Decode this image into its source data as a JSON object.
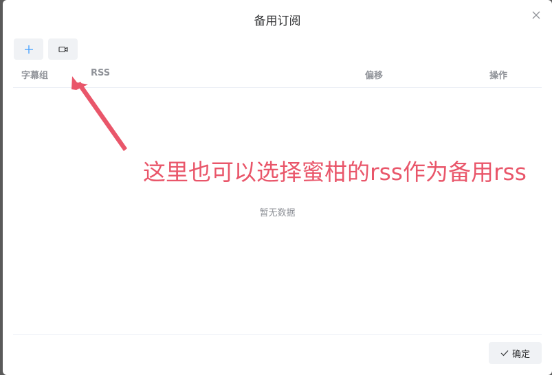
{
  "dialog": {
    "title": "备用订阅"
  },
  "toolbar": {
    "add_icon": "plus-icon",
    "video_icon": "video-camera-icon"
  },
  "table": {
    "columns": [
      "字幕组",
      "RSS",
      "偏移",
      "操作"
    ],
    "rows": [],
    "empty_text": "暂无数据"
  },
  "annotation": {
    "text": "这里也可以选择蜜柑的rss作为备用rss",
    "color": "#e9566a"
  },
  "footer": {
    "confirm_label": "确定",
    "confirm_icon": "check-icon"
  },
  "colors": {
    "header_text": "#909399",
    "title_text": "#303133",
    "accent": "#409eff",
    "annotation": "#e9566a"
  }
}
